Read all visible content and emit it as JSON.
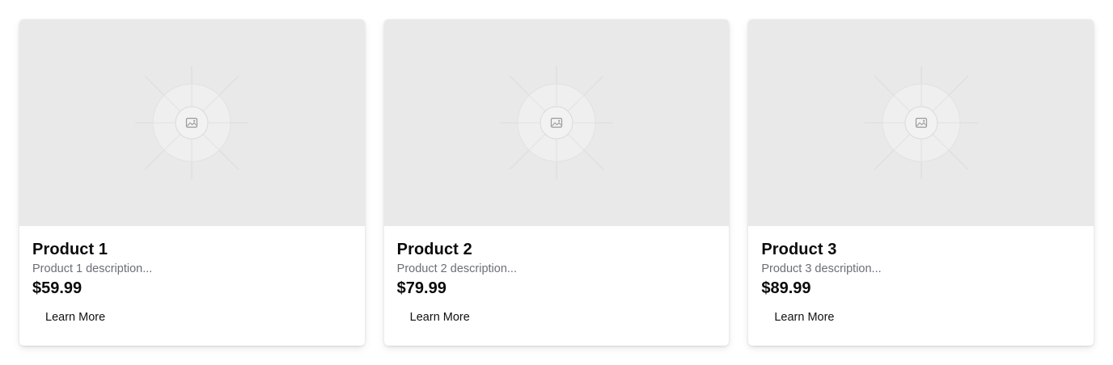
{
  "products": [
    {
      "title": "Product 1",
      "description": "Product 1 description...",
      "price": "$59.99",
      "button_label": "Learn More",
      "image_icon": "image-placeholder-icon"
    },
    {
      "title": "Product 2",
      "description": "Product 2 description...",
      "price": "$79.99",
      "button_label": "Learn More",
      "image_icon": "image-placeholder-icon"
    },
    {
      "title": "Product 3",
      "description": "Product 3 description...",
      "price": "$89.99",
      "button_label": "Learn More",
      "image_icon": "image-placeholder-icon"
    }
  ],
  "colors": {
    "placeholder_bg": "#e9e9e9",
    "title": "#0b0b0b",
    "description": "#6b6f76"
  }
}
